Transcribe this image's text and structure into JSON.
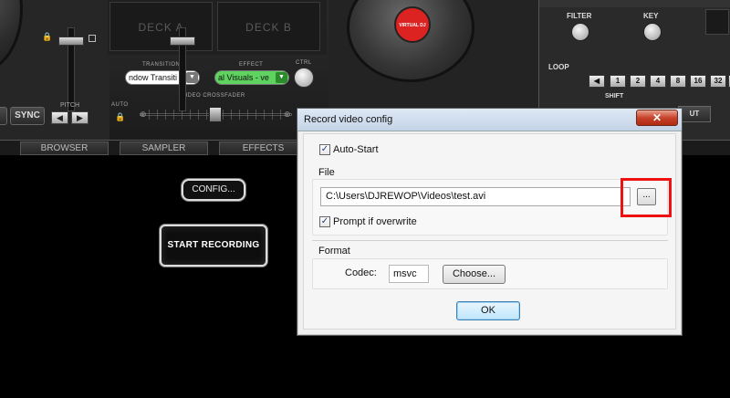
{
  "dj": {
    "deck_a_label": "DECK A",
    "deck_b_label": "DECK B",
    "transition_label": "TRANSITION",
    "transition_value": "ndow Transiti",
    "effect_label": "EFFECT",
    "effect_value": "al Visuals - ve",
    "ctrl_label": "CTRL",
    "auto_label": "AUTO",
    "crossfader_label": "VIDEO CROSSFADER",
    "sync_label": "SYNC",
    "pitch_label": "PITCH",
    "platter_logo_text": "VIRTUAL DJ",
    "filter_label": "FILTER",
    "key_label": "KEY",
    "loop_label": "LOOP",
    "shift_label": "SHIFT",
    "loop_buttons": [
      "◀",
      "1",
      "2",
      "4",
      "8",
      "16",
      "32",
      "▶"
    ],
    "cut_label": "UT"
  },
  "tabs": [
    "BROWSER",
    "SAMPLER",
    "EFFECTS"
  ],
  "record_panel": {
    "config_label": "CONFIG...",
    "start_recording_label": "START RECORDING"
  },
  "dialog": {
    "title": "Record video config",
    "close_label": "✕",
    "auto_start_label": "Auto-Start",
    "auto_start_checked": true,
    "file_group_label": "File",
    "file_path": "C:\\Users\\DJREWOP\\Videos\\test.avi",
    "browse_label": "...",
    "prompt_overwrite_label": "Prompt if overwrite",
    "prompt_overwrite_checked": true,
    "format_group_label": "Format",
    "codec_label": "Codec:",
    "codec_value": "msvc",
    "choose_label": "Choose...",
    "ok_label": "OK"
  },
  "colors": {
    "highlight": "#ee1111",
    "effect_select": "#5fd35f",
    "close_button": "#c7432b"
  }
}
